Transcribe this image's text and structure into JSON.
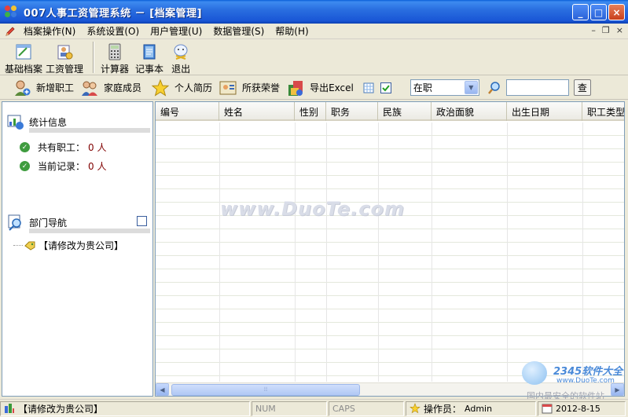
{
  "window": {
    "title": "007人事工资管理系统 － [档案管理]",
    "minimize_label": "_",
    "maximize_label": "□",
    "close_label": "×"
  },
  "menu": {
    "items": [
      "档案操作(N)",
      "系统设置(O)",
      "用户管理(U)",
      "数据管理(S)",
      "帮助(H)"
    ],
    "mdi_minimize": "–",
    "mdi_restore": "❐",
    "mdi_close": "×"
  },
  "toolbar": {
    "buttons": [
      {
        "label": "基础档案",
        "icon": "archive-icon"
      },
      {
        "label": "工资管理",
        "icon": "salary-icon"
      },
      {
        "label": "计算器",
        "icon": "calculator-icon"
      },
      {
        "label": "记事本",
        "icon": "notepad-icon"
      },
      {
        "label": "退出",
        "icon": "exit-icon"
      }
    ]
  },
  "subtoolbar": {
    "buttons": [
      {
        "label": "新增职工",
        "icon": "add-employee-icon"
      },
      {
        "label": "家庭成员",
        "icon": "family-icon"
      },
      {
        "label": "个人简历",
        "icon": "resume-icon"
      },
      {
        "label": "所获荣誉",
        "icon": "honor-icon"
      },
      {
        "label": "导出Excel",
        "icon": "excel-icon"
      }
    ],
    "status_select": "在职",
    "query_button": "查"
  },
  "left_panel": {
    "stats_title": "统计信息",
    "total_label": "共有职工：",
    "total_value": "0 人",
    "current_label": "当前记录：",
    "current_value": "0 人",
    "dept_title": "部门导航",
    "tree_root": "【请修改为贵公司】"
  },
  "grid": {
    "columns": [
      "编号",
      "姓名",
      "性别",
      "职务",
      "民族",
      "政治面貌",
      "出生日期",
      "职工类型"
    ],
    "scroll_thumb_glyph": "⦙⦙⦙"
  },
  "watermark": {
    "text": "www.DuoTe.com",
    "brand": "2345软件大全",
    "url": "www.DuoTe.com",
    "slogan": "国内最安全的软件站"
  },
  "statusbar": {
    "company": "【请修改为贵公司】",
    "num": "NUM",
    "caps": "CAPS",
    "operator_label": "操作员：",
    "operator": "Admin",
    "date": "2012-8-15"
  }
}
